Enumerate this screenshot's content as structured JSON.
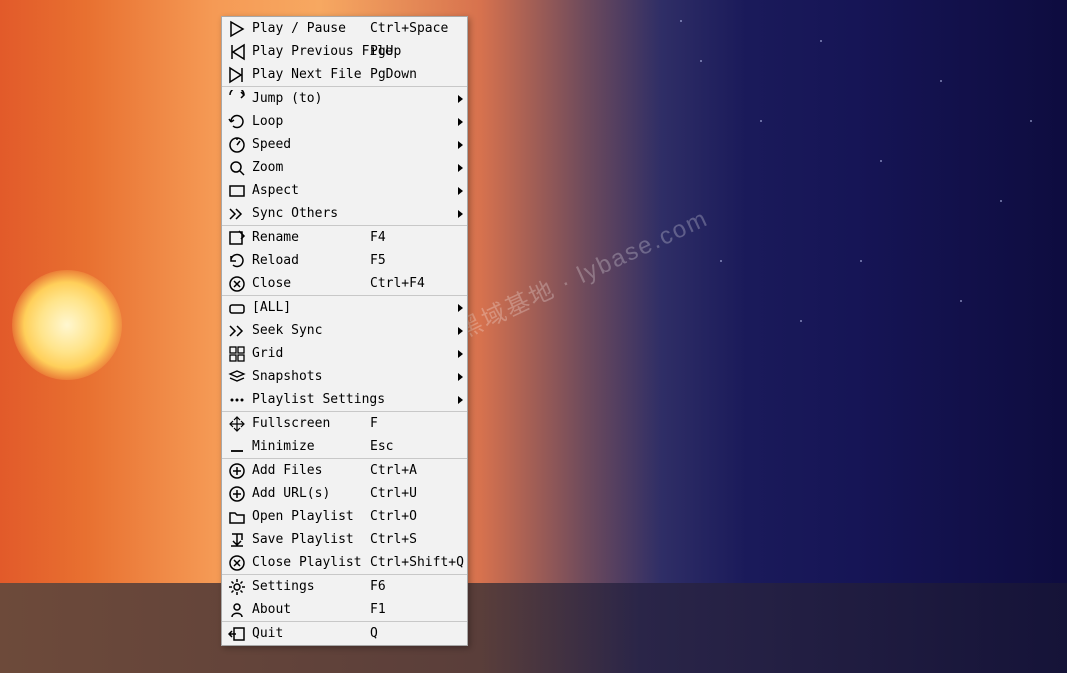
{
  "watermark": "记得收藏: 黑域基地 · lybase.com",
  "menu": {
    "items": [
      {
        "icon": "play-icon",
        "label": "Play / Pause",
        "shortcut": "Ctrl+Space"
      },
      {
        "icon": "prev-track-icon",
        "label": "Play Previous File",
        "shortcut": "PgUp"
      },
      {
        "icon": "next-track-icon",
        "label": "Play Next File",
        "shortcut": "PgDown"
      },
      {
        "sep": true
      },
      {
        "icon": "jump-icon",
        "label": "Jump (to)",
        "submenu": true
      },
      {
        "icon": "loop-icon",
        "label": "Loop",
        "submenu": true
      },
      {
        "icon": "speed-icon",
        "label": "Speed",
        "submenu": true
      },
      {
        "icon": "zoom-icon",
        "label": "Zoom",
        "submenu": true
      },
      {
        "icon": "aspect-icon",
        "label": "Aspect",
        "submenu": true
      },
      {
        "icon": "sync-icon",
        "label": "Sync Others",
        "submenu": true
      },
      {
        "sep": true
      },
      {
        "icon": "rename-icon",
        "label": "Rename",
        "shortcut": "F4"
      },
      {
        "icon": "reload-icon",
        "label": "Reload",
        "shortcut": "F5"
      },
      {
        "icon": "close-circle-icon",
        "label": "Close",
        "shortcut": "Ctrl+F4"
      },
      {
        "sep": true
      },
      {
        "icon": "all-icon",
        "label": "[ALL]",
        "submenu": true
      },
      {
        "icon": "seek-sync-icon",
        "label": "Seek Sync",
        "submenu": true
      },
      {
        "icon": "grid-icon",
        "label": "Grid",
        "submenu": true
      },
      {
        "icon": "snapshots-icon",
        "label": "Snapshots",
        "submenu": true
      },
      {
        "icon": "playlist-settings-icon",
        "label": "Playlist Settings",
        "submenu": true
      },
      {
        "sep": true
      },
      {
        "icon": "fullscreen-icon",
        "label": "Fullscreen",
        "shortcut": "F"
      },
      {
        "icon": "minimize-icon",
        "label": "Minimize",
        "shortcut": "Esc"
      },
      {
        "sep": true
      },
      {
        "icon": "add-files-icon",
        "label": "Add Files",
        "shortcut": "Ctrl+A"
      },
      {
        "icon": "add-url-icon",
        "label": "Add URL(s)",
        "shortcut": "Ctrl+U"
      },
      {
        "icon": "open-playlist-icon",
        "label": "Open Playlist",
        "shortcut": "Ctrl+O"
      },
      {
        "icon": "save-playlist-icon",
        "label": "Save Playlist",
        "shortcut": "Ctrl+S"
      },
      {
        "icon": "close-playlist-icon",
        "label": "Close Playlist",
        "shortcut": "Ctrl+Shift+Q"
      },
      {
        "sep": true
      },
      {
        "icon": "settings-icon",
        "label": "Settings",
        "shortcut": "F6"
      },
      {
        "icon": "about-icon",
        "label": "About",
        "shortcut": "F1"
      },
      {
        "sep": true
      },
      {
        "icon": "quit-icon",
        "label": "Quit",
        "shortcut": "Q"
      }
    ]
  }
}
